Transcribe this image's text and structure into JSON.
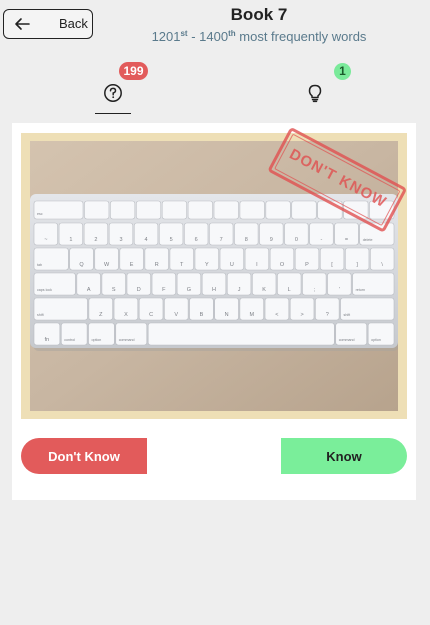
{
  "header": {
    "back_label": "Back",
    "title": "Book 7",
    "range_start": "1201",
    "range_start_suffix": "st",
    "range_sep": " - ",
    "range_end": "1400",
    "range_end_suffix": "th",
    "range_tail": " most frequently words"
  },
  "tabs": [
    {
      "icon": "question-circle-icon",
      "badge": "199",
      "badge_color": "#e25b5b",
      "active": true
    },
    {
      "icon": "lightbulb-icon",
      "badge": "1",
      "badge_color": "#7aea9a",
      "active": false
    }
  ],
  "card": {
    "image": "keyboard-photo",
    "stamp_text": "DON'T KNOW",
    "stamp_color": "#e05050"
  },
  "actions": {
    "dont_know_label": "Don't Know",
    "know_label": "Know",
    "dont_know_color": "#e25b5b",
    "know_color": "#7aee9a"
  },
  "keyboard": {
    "row1": [
      "esc",
      "",
      "",
      "",
      "",
      "",
      "",
      "",
      "",
      "",
      "",
      "",
      ""
    ],
    "row2": [
      "~",
      "1",
      "2",
      "3",
      "4",
      "5",
      "6",
      "7",
      "8",
      "9",
      "0",
      "-",
      "=",
      "delete"
    ],
    "row3": [
      "tab",
      "Q",
      "W",
      "E",
      "R",
      "T",
      "Y",
      "U",
      "I",
      "O",
      "P",
      "[",
      "]",
      "\\"
    ],
    "row4": [
      "caps lock",
      "A",
      "S",
      "D",
      "F",
      "G",
      "H",
      "J",
      "K",
      "L",
      ";",
      "'",
      "return"
    ],
    "row5": [
      "shift",
      "Z",
      "X",
      "C",
      "V",
      "B",
      "N",
      "M",
      "<",
      ">",
      "?",
      "shift"
    ],
    "row6": [
      "fn",
      "control",
      "option",
      "command",
      "",
      "command",
      "option"
    ]
  }
}
